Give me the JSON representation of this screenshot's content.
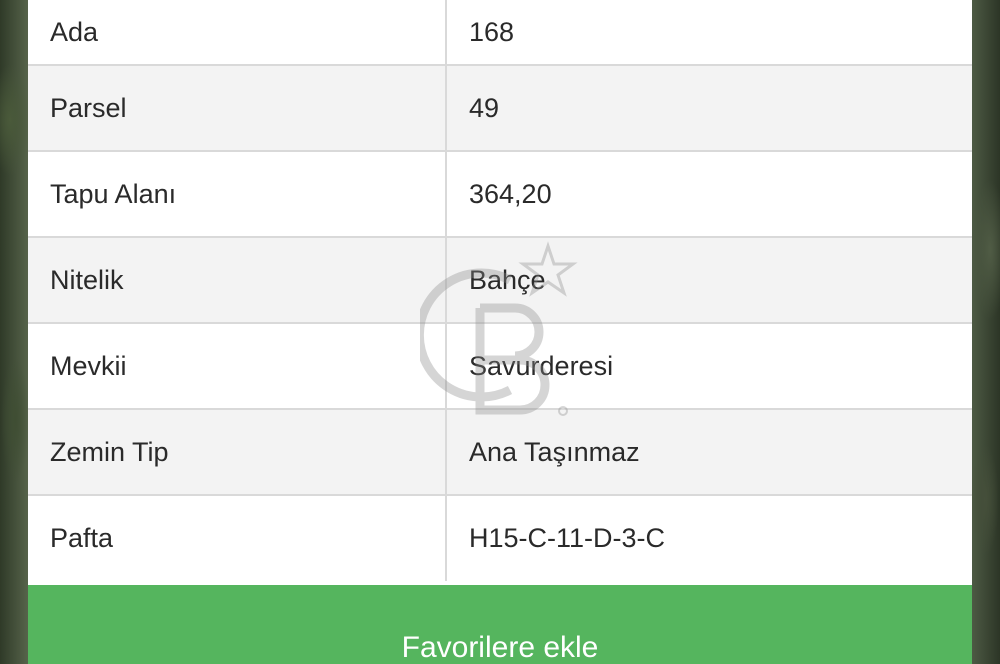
{
  "rows": [
    {
      "label": "Ada",
      "value": "168"
    },
    {
      "label": "Parsel",
      "value": "49"
    },
    {
      "label": "Tapu Alanı",
      "value": "364,20"
    },
    {
      "label": "Nitelik",
      "value": "Bahçe"
    },
    {
      "label": "Mevkii",
      "value": "Savurderesi"
    },
    {
      "label": "Zemin Tip",
      "value": "Ana Taşınmaz"
    },
    {
      "label": "Pafta",
      "value": "H15-C-11-D-3-C"
    }
  ],
  "actions": {
    "favorite_label": "Favorilere ekle"
  },
  "icons": {
    "watermark": "cb-star-logo-icon"
  },
  "colors": {
    "button": "#55b55e",
    "row_alt": "#f3f3f3",
    "divider": "#d9d9d9"
  }
}
